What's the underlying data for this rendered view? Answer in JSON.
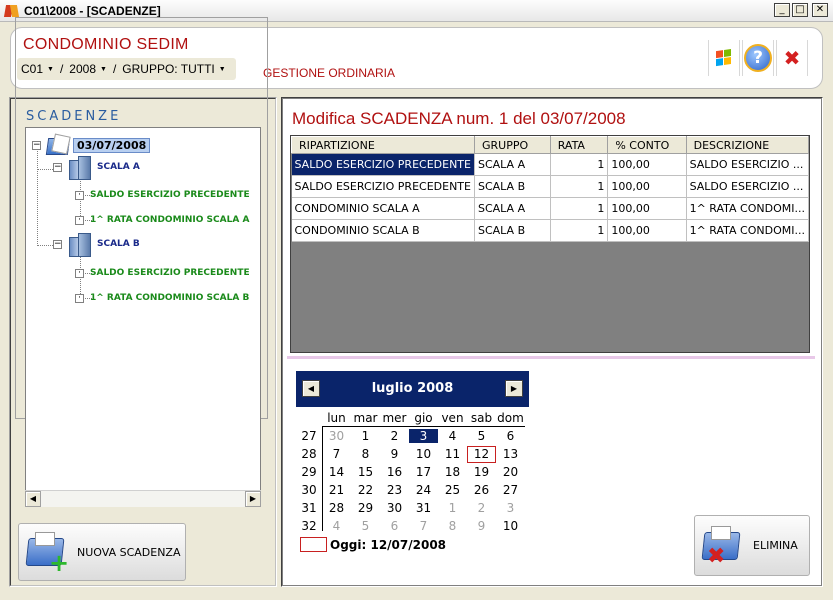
{
  "window": {
    "title": "C01\\2008 - [SCADENZE]",
    "buttons": {
      "minimize": "_",
      "maximize": "□",
      "close": "✕"
    }
  },
  "header": {
    "condominio": "CONDOMINIO SEDIM",
    "selectors": {
      "code": "C01",
      "year": "2008",
      "group": "GRUPPO: TUTTI",
      "separator": "/"
    },
    "gestione": "GESTIONE ORDINARIA",
    "icons": [
      "windows-icon",
      "help-icon",
      "close-icon"
    ]
  },
  "left": {
    "legend": "SCADENZE",
    "tree": {
      "date": "03/07/2008",
      "scale": [
        {
          "label": "SCALA A",
          "items": [
            "SALDO ESERCIZIO PRECEDENTE",
            "1^ RATA CONDOMINIO SCALA A"
          ]
        },
        {
          "label": "SCALA B",
          "items": [
            "SALDO ESERCIZIO PRECEDENTE",
            "1^ RATA CONDOMINIO SCALA B"
          ]
        }
      ]
    },
    "new_button": "NUOVA SCADENZA"
  },
  "right": {
    "title": "Modifica SCADENZA num. 1 del 03/07/2008",
    "table": {
      "columns": [
        "RIPARTIZIONE",
        "GRUPPO",
        "RATA",
        "% CONTO",
        "DESCRIZIONE"
      ],
      "rows": [
        [
          "SALDO ESERCIZIO PRECEDENTE",
          "SCALA A",
          "1",
          "100,00",
          "SALDO ESERCIZIO ..."
        ],
        [
          "SALDO ESERCIZIO PRECEDENTE",
          "SCALA B",
          "1",
          "100,00",
          "SALDO ESERCIZIO ..."
        ],
        [
          "CONDOMINIO SCALA A",
          "SCALA A",
          "1",
          "100,00",
          "1^ RATA CONDOMI..."
        ],
        [
          "CONDOMINIO SCALA B",
          "SCALA B",
          "1",
          "100,00",
          "1^ RATA CONDOMI..."
        ]
      ]
    },
    "calendar": {
      "month": "luglio 2008",
      "prev": "◀",
      "next": "▶",
      "weekdays": [
        "lun",
        "mar",
        "mer",
        "gio",
        "ven",
        "sab",
        "dom"
      ],
      "weeks": [
        {
          "num": "27",
          "days": [
            "30",
            "1",
            "2",
            "3",
            "4",
            "5",
            "6"
          ]
        },
        {
          "num": "28",
          "days": [
            "7",
            "8",
            "9",
            "10",
            "11",
            "12",
            "13"
          ]
        },
        {
          "num": "29",
          "days": [
            "14",
            "15",
            "16",
            "17",
            "18",
            "19",
            "20"
          ]
        },
        {
          "num": "30",
          "days": [
            "21",
            "22",
            "23",
            "24",
            "25",
            "26",
            "27"
          ]
        },
        {
          "num": "31",
          "days": [
            "28",
            "29",
            "30",
            "31",
            "1",
            "2",
            "3"
          ]
        },
        {
          "num": "32",
          "days": [
            "4",
            "5",
            "6",
            "7",
            "8",
            "9",
            "10"
          ]
        }
      ],
      "selected": "3",
      "today_label": "Oggi: 12/07/2008"
    },
    "delete_button": "ELIMINA"
  }
}
